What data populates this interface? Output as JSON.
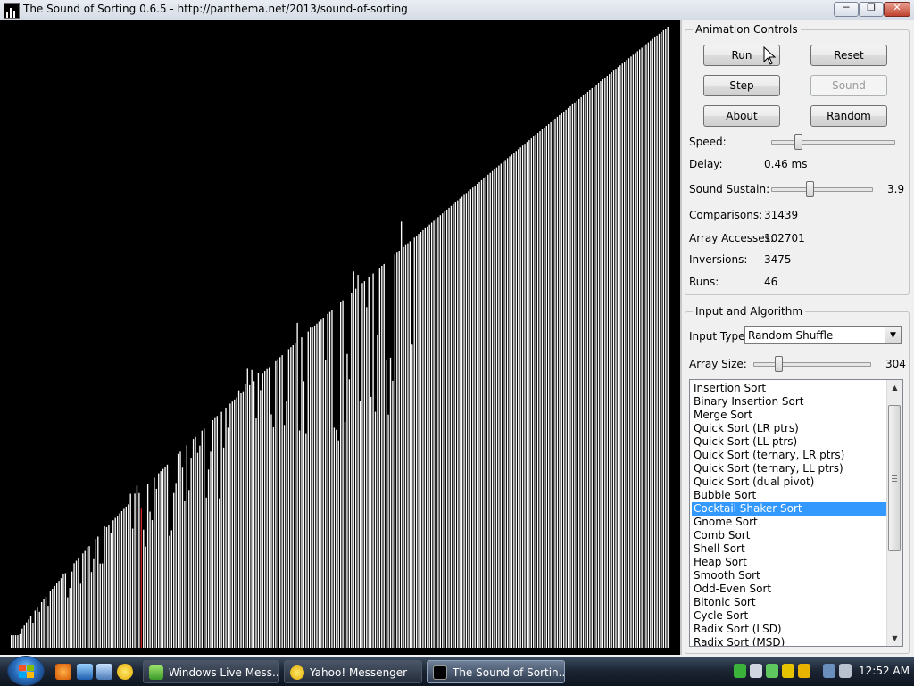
{
  "window": {
    "title": "The Sound of Sorting 0.6.5 - http://panthema.net/2013/sound-of-sorting",
    "min_icon": "minimize-icon",
    "max_icon": "maximize-icon",
    "close_icon": "close-icon"
  },
  "visualization": {
    "array_size": 304,
    "highlight_index": 60,
    "bar_color": "#ffffff",
    "highlight_color": "#cc2222",
    "background": "#000000"
  },
  "animation_controls": {
    "legend": "Animation Controls",
    "buttons": {
      "run": "Run",
      "reset": "Reset",
      "step": "Step",
      "sound": "Sound",
      "about": "About",
      "random": "Random"
    },
    "speed_label": "Speed:",
    "speed_level": 0.2,
    "delay_label": "Delay:",
    "delay_value": "0.46 ms",
    "sustain_label": "Sound Sustain:",
    "sustain_level": 0.38,
    "sustain_value": "3.9",
    "comparisons_label": "Comparisons:",
    "comparisons_value": "31439",
    "accesses_label": "Array Accesses:",
    "accesses_value": "102701",
    "inversions_label": "Inversions:",
    "inversions_value": "3475",
    "runs_label": "Runs:",
    "runs_value": "46"
  },
  "input_algorithm": {
    "legend": "Input and Algorithm",
    "input_type_label": "Input Type:",
    "input_type_value": "Random Shuffle",
    "array_size_label": "Array Size:",
    "array_size_level": 0.2,
    "array_size_value": "304",
    "algorithms": [
      "Insertion Sort",
      "Binary Insertion Sort",
      "Merge Sort",
      "Quick Sort (LR ptrs)",
      "Quick Sort (LL ptrs)",
      "Quick Sort (ternary, LR ptrs)",
      "Quick Sort (ternary, LL ptrs)",
      "Quick Sort (dual pivot)",
      "Bubble Sort",
      "Cocktail Shaker Sort",
      "Gnome Sort",
      "Comb Sort",
      "Shell Sort",
      "Heap Sort",
      "Smooth Sort",
      "Odd-Even Sort",
      "Bitonic Sort",
      "Cycle Sort",
      "Radix Sort (LSD)",
      "Radix Sort (MSD)"
    ],
    "selected_algorithm": "Cocktail Shaker Sort"
  },
  "taskbar": {
    "tasks": [
      {
        "label": "Windows Live Mess...",
        "icon": "messenger-icon"
      },
      {
        "label": "Yahoo! Messenger",
        "icon": "yahoo-icon"
      },
      {
        "label": "The Sound of Sortin...",
        "icon": "sorting-app-icon"
      }
    ],
    "clock": "12:52 AM"
  },
  "colors": {
    "selection": "#3399ff",
    "accent": "#2a6fbf"
  }
}
